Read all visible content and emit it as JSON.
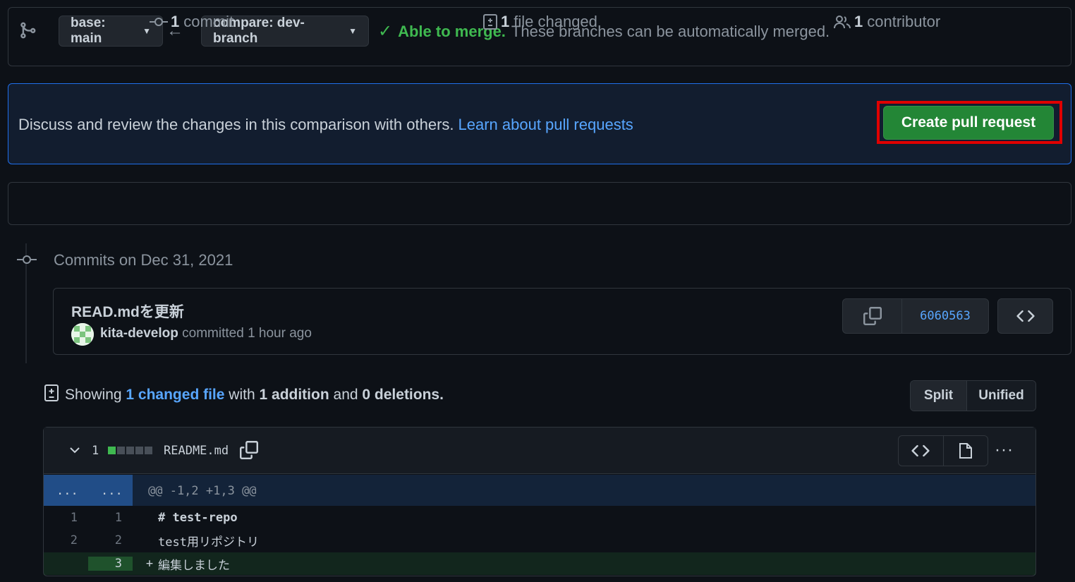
{
  "compare": {
    "base_label": "base: main",
    "compare_label": "compare: dev-branch",
    "merge_ok": "Able to merge.",
    "merge_desc": "These branches can be automatically merged."
  },
  "pr_prompt": {
    "text": "Discuss and review the changes in this comparison with others.",
    "link": "Learn about pull requests",
    "button": "Create pull request"
  },
  "summary": {
    "commits_count": "1",
    "commits_label": "commit",
    "files_count": "1",
    "files_label": "file changed",
    "contributors_count": "1",
    "contributors_label": "contributor"
  },
  "commits": {
    "date_heading": "Commits on Dec 31, 2021",
    "items": [
      {
        "title": "READ.mdを更新",
        "author": "kita-develop",
        "action": "committed 1 hour ago",
        "sha": "6060563"
      }
    ]
  },
  "diff_summary": {
    "showing": "Showing",
    "changed_files": "1 changed file",
    "with": "with",
    "additions": "1 addition",
    "and": "and",
    "deletions": "0 deletions",
    "period": ".",
    "split_label": "Split",
    "unified_label": "Unified"
  },
  "file": {
    "changes": "1",
    "name": "README.md",
    "hunk_header": "@@ -1,2 +1,3 @@",
    "hunk_gutter_left": "...",
    "hunk_gutter_right": "...",
    "lines": [
      {
        "old": "1",
        "new": "1",
        "marker": "",
        "text": "# test-repo"
      },
      {
        "old": "2",
        "new": "2",
        "marker": "",
        "text": "test用リポジトリ"
      },
      {
        "old": "",
        "new": "3",
        "marker": "+",
        "text": "編集しました"
      }
    ]
  },
  "colors": {
    "accent_green": "#238636",
    "success_text": "#3fb950",
    "link_blue": "#58a6ff",
    "highlight_red": "#e00000"
  }
}
